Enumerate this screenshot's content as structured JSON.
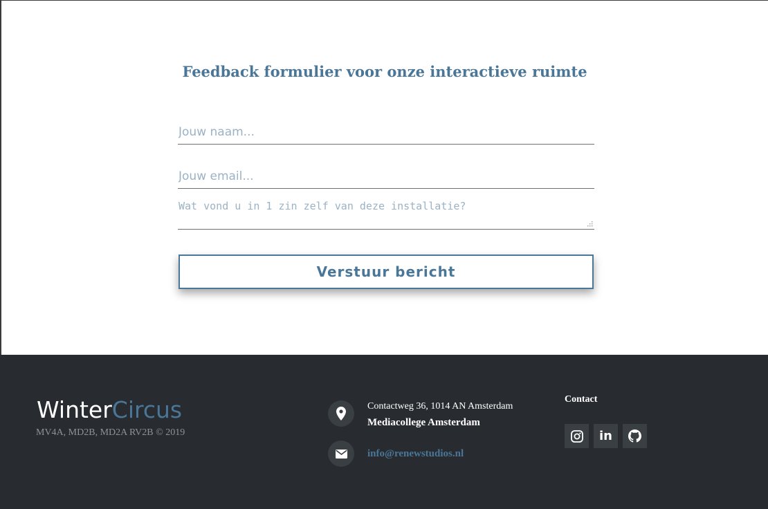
{
  "form": {
    "title": "Feedback formulier voor onze interactieve ruimte",
    "name_placeholder": "Jouw naam...",
    "email_placeholder": "Jouw email...",
    "message_placeholder": "Wat vond u in 1 zin zelf van deze installatie?",
    "submit_label": "Verstuur bericht"
  },
  "footer": {
    "logo_part1": "Winter",
    "logo_part2": "Circus",
    "copyright": "MV4A, MD2B, MD2A RV2B © 2019",
    "address_line": "Contactweg 36, 1014 AN Amsterdam",
    "address_name": "Mediacollege Amsterdam",
    "email": "info@renewstudios.nl",
    "contact_title": "Contact",
    "social": [
      {
        "icon": "instagram-icon"
      },
      {
        "icon": "linkedin-icon"
      },
      {
        "icon": "github-icon"
      }
    ]
  },
  "colors": {
    "accent": "#4a7698",
    "footer_bg": "#282c30",
    "icon_bg": "#3a3f44",
    "placeholder": "#9bb2c4"
  }
}
